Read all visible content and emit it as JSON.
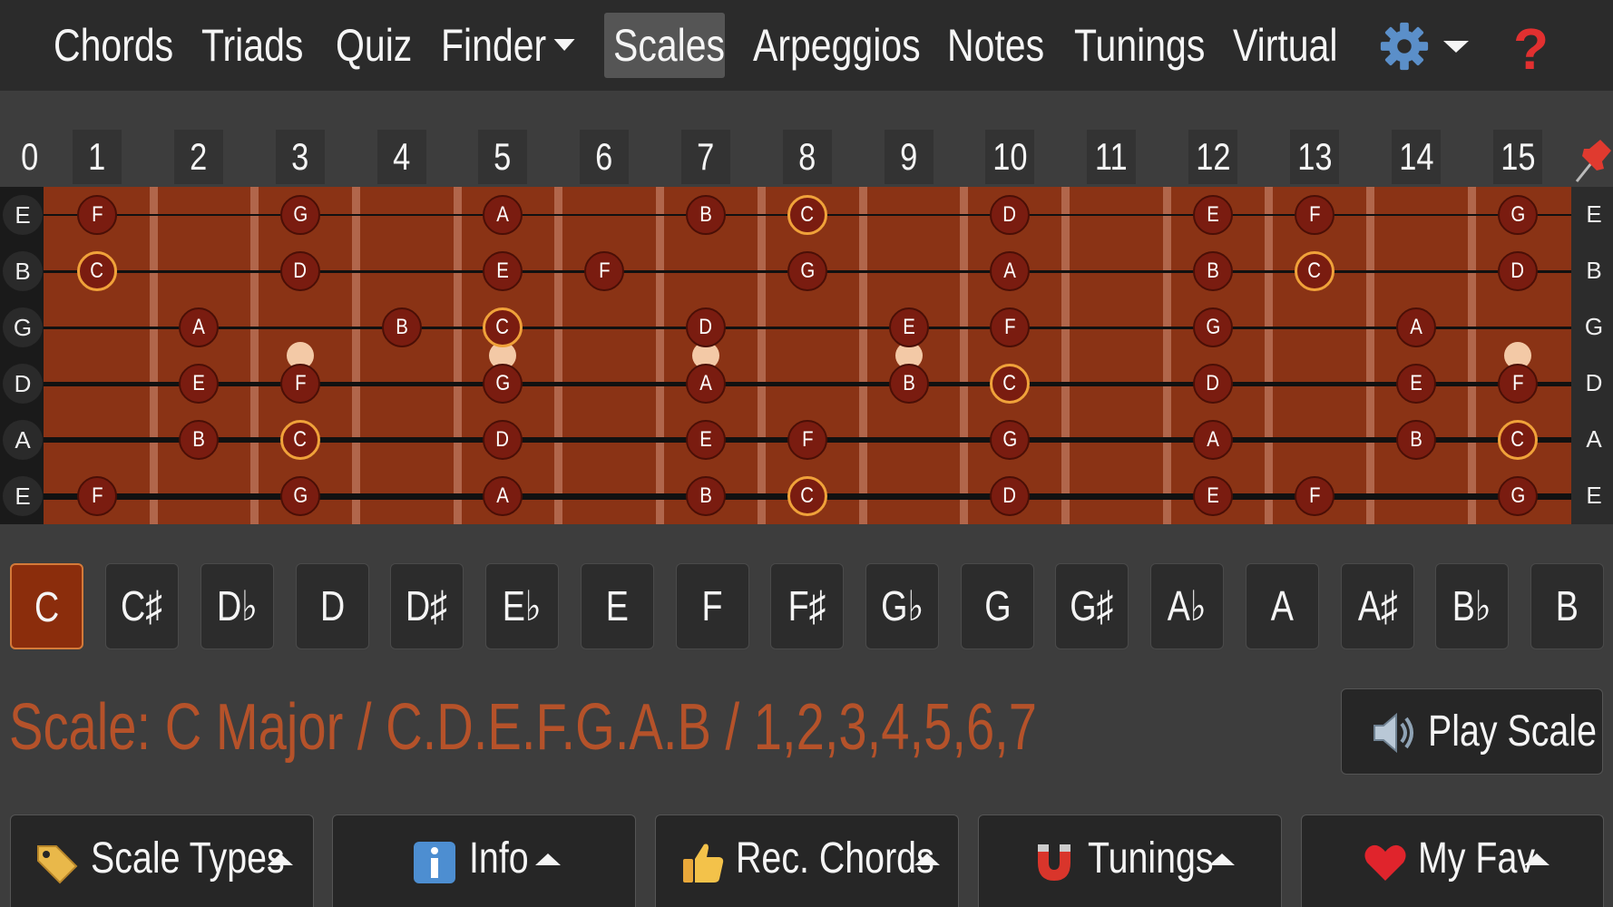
{
  "nav": {
    "items": [
      "Chords",
      "Triads",
      "Quiz",
      "Finder",
      "Scales",
      "Arpeggios",
      "Notes",
      "Tunings",
      "Virtual"
    ],
    "active": "Scales",
    "help_symbol": "?"
  },
  "fret_numbers": [
    "0",
    "1",
    "2",
    "3",
    "4",
    "5",
    "6",
    "7",
    "8",
    "9",
    "10",
    "11",
    "12",
    "13",
    "14",
    "15"
  ],
  "strings": [
    {
      "open": "E",
      "notes": [
        [
          1,
          "F"
        ],
        [
          3,
          "G"
        ],
        [
          5,
          "A"
        ],
        [
          7,
          "B"
        ],
        [
          8,
          "C"
        ],
        [
          10,
          "D"
        ],
        [
          12,
          "E"
        ],
        [
          13,
          "F"
        ],
        [
          15,
          "G"
        ]
      ]
    },
    {
      "open": "B",
      "notes": [
        [
          1,
          "C"
        ],
        [
          3,
          "D"
        ],
        [
          5,
          "E"
        ],
        [
          6,
          "F"
        ],
        [
          8,
          "G"
        ],
        [
          10,
          "A"
        ],
        [
          12,
          "B"
        ],
        [
          13,
          "C"
        ],
        [
          15,
          "D"
        ]
      ]
    },
    {
      "open": "G",
      "notes": [
        [
          2,
          "A"
        ],
        [
          4,
          "B"
        ],
        [
          5,
          "C"
        ],
        [
          7,
          "D"
        ],
        [
          9,
          "E"
        ],
        [
          10,
          "F"
        ],
        [
          12,
          "G"
        ],
        [
          14,
          "A"
        ]
      ]
    },
    {
      "open": "D",
      "notes": [
        [
          2,
          "E"
        ],
        [
          3,
          "F"
        ],
        [
          5,
          "G"
        ],
        [
          7,
          "A"
        ],
        [
          9,
          "B"
        ],
        [
          10,
          "C"
        ],
        [
          12,
          "D"
        ],
        [
          14,
          "E"
        ],
        [
          15,
          "F"
        ]
      ]
    },
    {
      "open": "A",
      "notes": [
        [
          2,
          "B"
        ],
        [
          3,
          "C"
        ],
        [
          5,
          "D"
        ],
        [
          7,
          "E"
        ],
        [
          8,
          "F"
        ],
        [
          10,
          "G"
        ],
        [
          12,
          "A"
        ],
        [
          14,
          "B"
        ],
        [
          15,
          "C"
        ]
      ]
    },
    {
      "open": "E",
      "notes": [
        [
          1,
          "F"
        ],
        [
          3,
          "G"
        ],
        [
          5,
          "A"
        ],
        [
          7,
          "B"
        ],
        [
          8,
          "C"
        ],
        [
          10,
          "D"
        ],
        [
          12,
          "E"
        ],
        [
          13,
          "F"
        ],
        [
          15,
          "G"
        ]
      ]
    }
  ],
  "root_note": "C",
  "inlay_frets": [
    3,
    5,
    7,
    9,
    15
  ],
  "keys": [
    "C",
    "C♯",
    "D♭",
    "D",
    "D♯",
    "E♭",
    "E",
    "F",
    "F♯",
    "G♭",
    "G",
    "G♯",
    "A♭",
    "A",
    "A♯",
    "B♭",
    "B"
  ],
  "selected_key": "C",
  "scale_info": "Scale: C Major / C.D.E.F.G.A.B / 1,2,3,4,5,6,7",
  "play_button": {
    "label": "Play Scale",
    "icon": "speaker-icon"
  },
  "bottom_tabs": [
    {
      "label": "Scale Types",
      "icon": "tag-icon"
    },
    {
      "label": "Info",
      "icon": "info-icon"
    },
    {
      "label": "Rec. Chords",
      "icon": "thumbs-up-icon"
    },
    {
      "label": "Tunings",
      "icon": "magnet-icon"
    },
    {
      "label": "My Fav",
      "icon": "heart-icon"
    }
  ],
  "colors": {
    "accent": "#b5522a",
    "fretboard": "#8a3315",
    "note_fill": "#7a1c10",
    "root_ring": "#f0a23a",
    "help": "#e23030"
  }
}
